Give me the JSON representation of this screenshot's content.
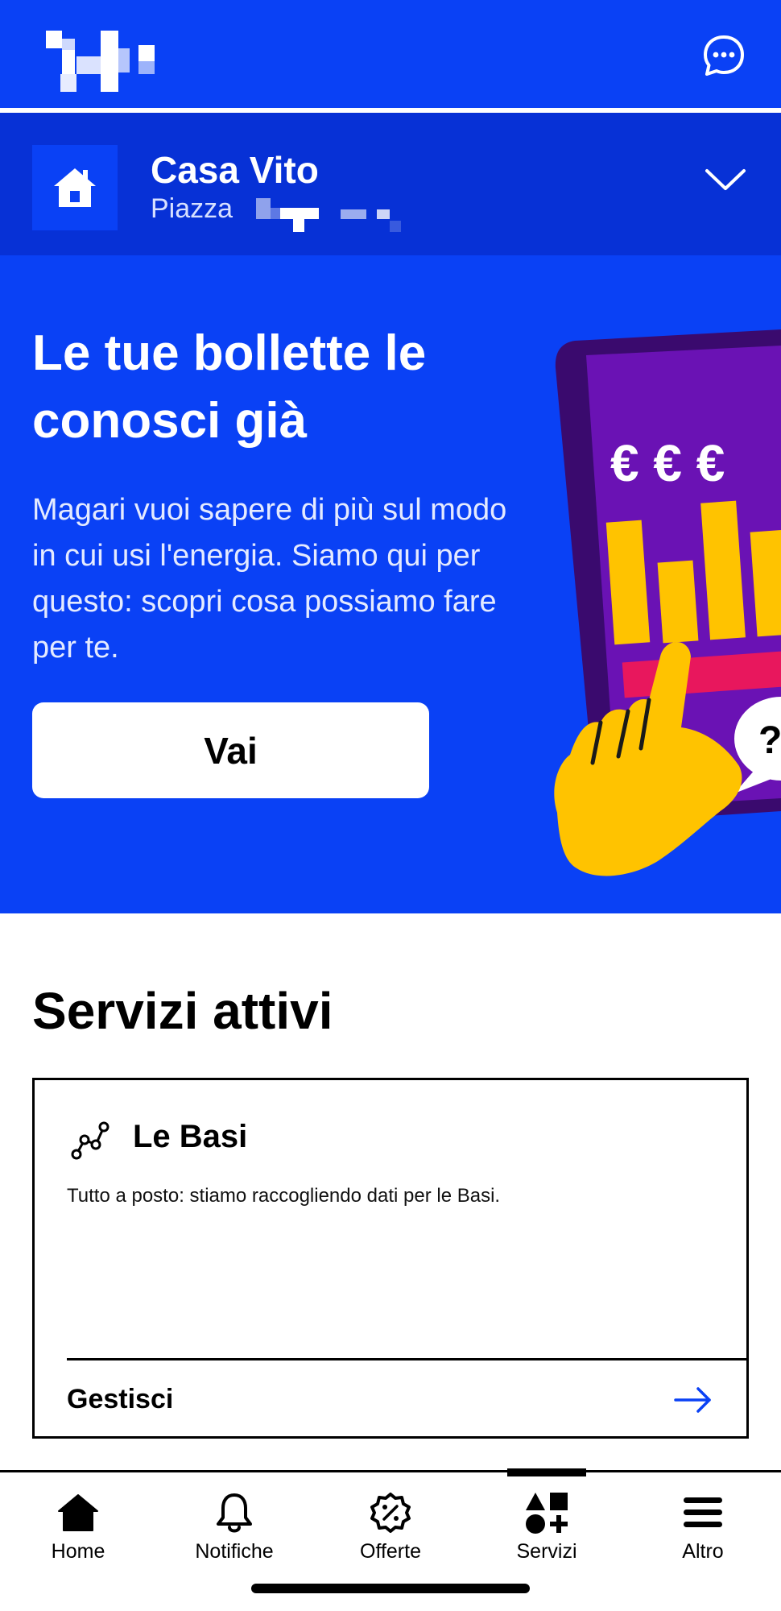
{
  "header": {
    "chat_button_label": "Chat"
  },
  "location": {
    "title": "Casa Vito",
    "subtitle": "Piazza"
  },
  "hero": {
    "title": "Le tue bollette le conosci già",
    "text": "Magari vuoi sapere di più sul modo in cui usi l'energia. Siamo qui per questo: scopri cosa possiamo fare per te.",
    "button_label": "Vai",
    "illustration_symbols": "€ € €",
    "bubble_symbol": "?"
  },
  "services": {
    "section_title": "Servizi attivi",
    "card": {
      "title": "Le Basi",
      "text": "Tutto a posto: stiamo raccogliendo dati per le Basi.",
      "link_label": "Gestisci"
    }
  },
  "bottom_nav": {
    "items": [
      {
        "label": "Home",
        "icon": "home-icon"
      },
      {
        "label": "Notifiche",
        "icon": "bell-icon"
      },
      {
        "label": "Offerte",
        "icon": "discount-badge-icon"
      },
      {
        "label": "Servizi",
        "icon": "services-shapes-icon"
      },
      {
        "label": "Altro",
        "icon": "menu-icon"
      }
    ],
    "active": "Servizi"
  },
  "colors": {
    "brand_blue": "#0a41f5",
    "dark_blue": "#0731d6",
    "illustration_purple": "#6a12b4",
    "illustration_yellow": "#ffc300",
    "illustration_pink": "#e8175d",
    "arrow_blue": "#0a41f5"
  }
}
